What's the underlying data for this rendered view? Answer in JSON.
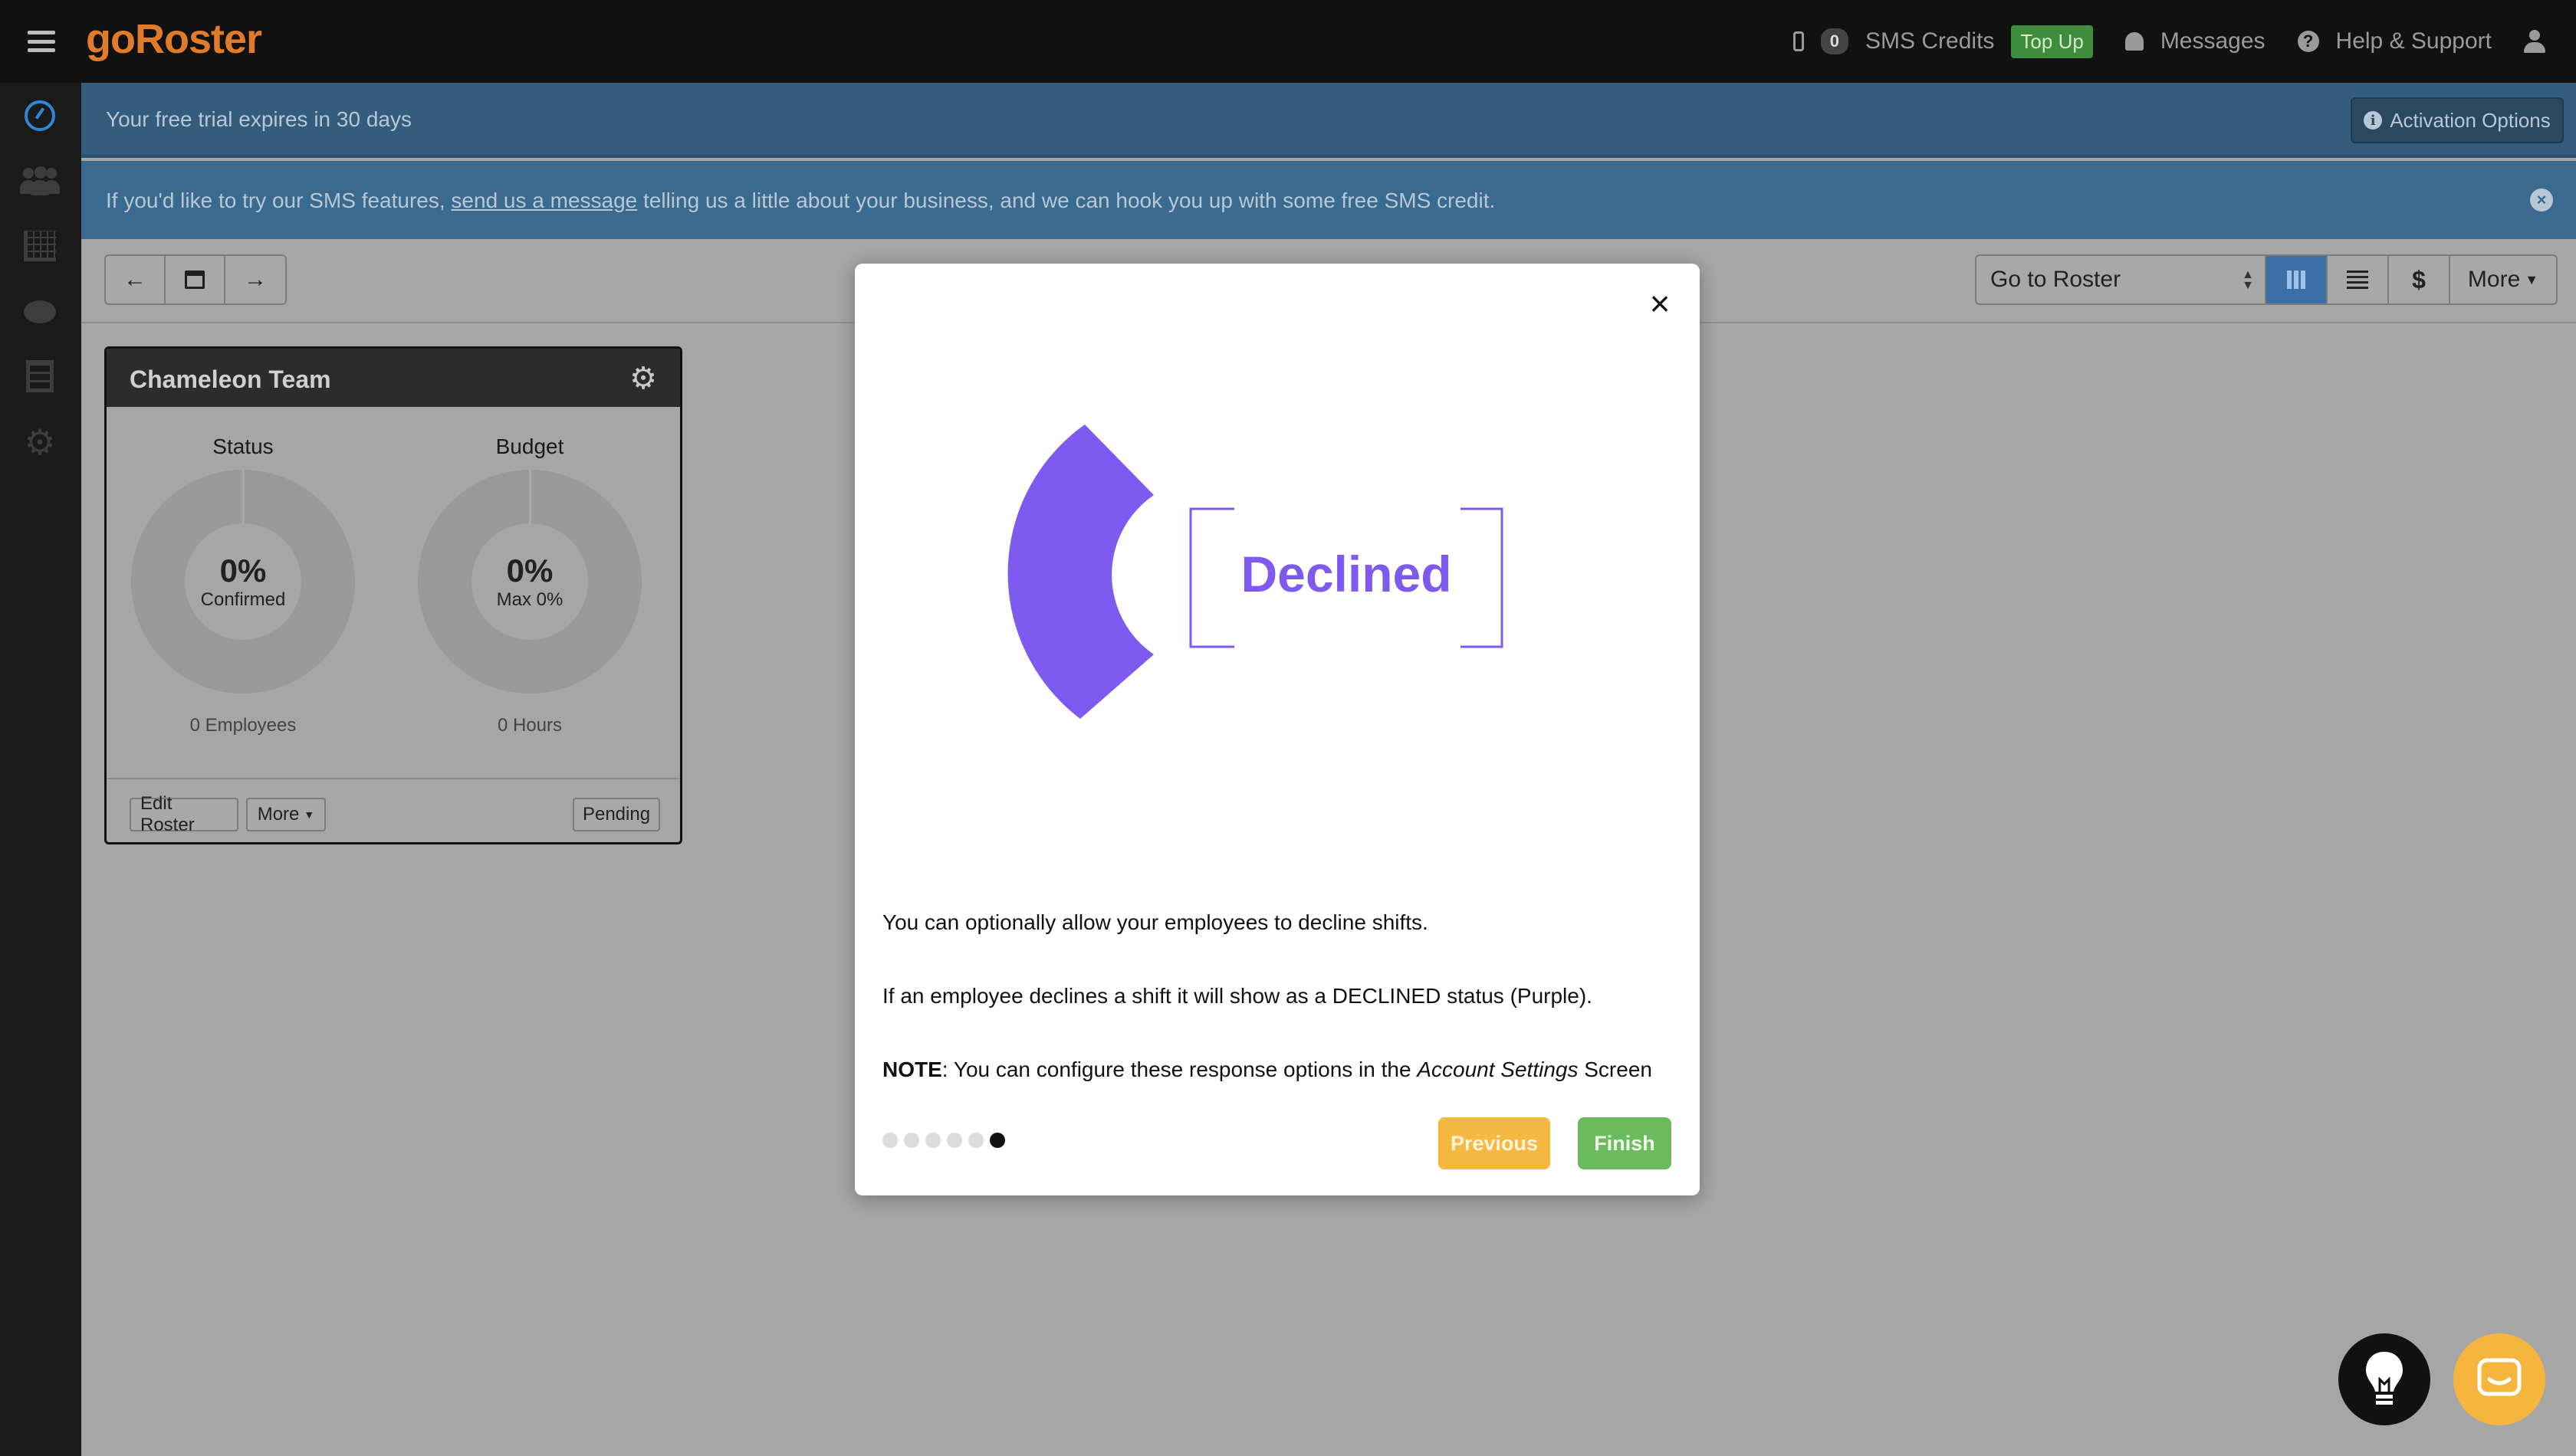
{
  "app": {
    "logo_go": "go",
    "logo_roster": "Roster"
  },
  "topbar": {
    "sms_credit_count": "0",
    "sms_credits_label": "SMS Credits",
    "top_up_label": "Top Up",
    "messages_label": "Messages",
    "help_label": "Help & Support"
  },
  "sidebar": {
    "items": [
      {
        "icon": "dashboard-icon",
        "active": true
      },
      {
        "icon": "people-icon"
      },
      {
        "icon": "chart-icon"
      },
      {
        "icon": "chat-icon"
      },
      {
        "icon": "film-icon"
      },
      {
        "icon": "gear-icon"
      }
    ]
  },
  "banners": {
    "trial_text": "Your free trial expires in 30 days",
    "activation_label": "Activation Options",
    "sms_text_before": "If you'd like to try our SMS features, ",
    "sms_link": "send us a message",
    "sms_text_after": " telling us a little about your business, and we can hook you up with some free SMS credit."
  },
  "toolbar": {
    "goto_value": "Go to Roster",
    "currency_symbol": "$",
    "more_label": "More"
  },
  "team_card": {
    "title": "Chameleon Team",
    "status": {
      "label": "Status",
      "value": "0%",
      "sub": "Confirmed",
      "foot": "0 Employees"
    },
    "budget": {
      "label": "Budget",
      "value": "0%",
      "sub": "Max 0%",
      "foot": "0 Hours"
    },
    "edit_label": "Edit Roster",
    "more_label": "More",
    "pending_label": "Pending"
  },
  "modal": {
    "badge_text": "Declined",
    "line1": "You can optionally allow your employees to decline shifts.",
    "line2": "If an employee declines a shift it will show as a DECLINED status (Purple).",
    "note_label": "NOTE",
    "note_text": ": You can configure these response options in the ",
    "note_emph": "Account Settings",
    "note_tail": " Screen",
    "total_steps": 6,
    "current_step": 6,
    "prev_label": "Previous",
    "finish_label": "Finish"
  },
  "colors": {
    "accent_purple": "#7f5af0",
    "brand_orange": "#e07b2a",
    "prev_yellow": "#f5b942",
    "finish_green": "#6cbb5f"
  }
}
